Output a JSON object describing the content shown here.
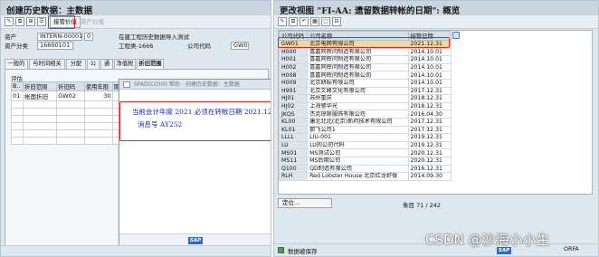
{
  "left": {
    "title": "创建历史数据：主数据",
    "toolbar": {
      "save_values_label": "接管价值",
      "asset_value_label": "资产价值"
    },
    "form": {
      "asset_label": "资产",
      "asset_value": "INTERN-00001",
      "asset_sub": "0",
      "asset_desc": "在建工程历史数据导入测试",
      "class_label": "资产分类",
      "class_value": "16600101",
      "class_desc": "工程类-1666",
      "company_label": "公司代码",
      "company_value": "GW01"
    },
    "tabs": [
      "一般的",
      "与时间相关",
      "分配",
      "公",
      "通",
      "净值税",
      "折旧范围"
    ],
    "group_label": "评估",
    "table": {
      "headers": [
        "B..",
        "折旧范围",
        "折旧码",
        "使用年限",
        "期"
      ],
      "rows": [
        {
          "b": "01",
          "area": "帐面折旧",
          "key": "GW02",
          "life": "30",
          "period": ""
        }
      ]
    },
    "popup": {
      "title": "SPAD(CO)00 帮助 - 创建历史数据：主数据",
      "message": "当前会计年度 2021 必须在转帐日期 2021.12.31 之后",
      "message_id": "消息号 AY252"
    }
  },
  "right": {
    "title": "更改视图 \"FI-AA: 遗留数据转帐的日期\": 概览",
    "table": {
      "headers": [
        "公司代码",
        "公司名称",
        "接管日期"
      ],
      "rows": [
        {
          "code": "GW01",
          "name": "北京电网有限公司",
          "date": "2021.12.31",
          "selected": true
        },
        {
          "code": "H000",
          "name": "喜嘉同辉问制造有限公司",
          "date": "2014.10.01"
        },
        {
          "code": "H001",
          "name": "喜嘉同辉问制造有限公司",
          "date": "2014.10.01"
        },
        {
          "code": "H002",
          "name": "喜嘉同辉问制造有限公司",
          "date": "2014.10.01"
        },
        {
          "code": "H008",
          "name": "喜嘉同辉问制造有限公司",
          "date": "2014.10.01"
        },
        {
          "code": "H009",
          "name": "北京耕耘有限公司",
          "date": "2014.10.01"
        },
        {
          "code": "H991",
          "name": "北京文峰文化有限公司",
          "date": "2017.12.31"
        },
        {
          "code": "HJ01",
          "name": "苏州重庆",
          "date": "2018.12.31"
        },
        {
          "code": "HJ02",
          "name": "上海警华光",
          "date": "2018.12.31"
        },
        {
          "code": "JKQS",
          "name": "杰克琼斯服饰有限公司",
          "date": "2016.04.30"
        },
        {
          "code": "KL00",
          "name": "康北北北(北京)新药技术有限公司",
          "date": "2017.12.31"
        },
        {
          "code": "KL01",
          "name": "那飞公司1",
          "date": "2017.12.31"
        },
        {
          "code": "LLLL",
          "name": "LIU-001",
          "date": "2019.12.31"
        },
        {
          "code": "LU",
          "name": "LU的公司代码",
          "date": "2019.12.31"
        },
        {
          "code": "MS01",
          "name": "MS测试公司",
          "date": "2020.12.31"
        },
        {
          "code": "MS11",
          "name": "MS后期公司",
          "date": "2020.12.31"
        },
        {
          "code": "Q100",
          "name": "QD制造有限公司",
          "date": "2016.12.31"
        },
        {
          "code": "RLH",
          "name": "Red Lobster House 北京红龙虾餐",
          "date": "2014.09.30"
        }
      ]
    },
    "locate_label": "定位...",
    "entry_label": "条目 71 / 242",
    "status_text": "数据被保存",
    "status_right": "ORFA"
  },
  "logo_text": "SAP",
  "watermark": "CSDN @沙海小小生"
}
